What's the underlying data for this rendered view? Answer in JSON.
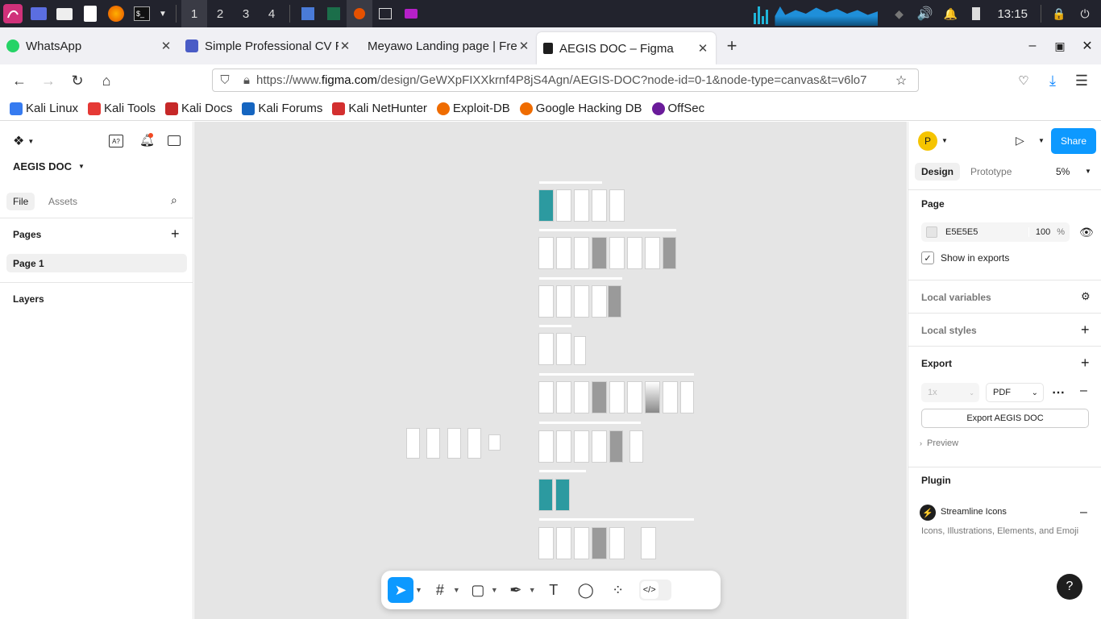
{
  "taskbar": {
    "workspaces": [
      "1",
      "2",
      "3",
      "4"
    ],
    "clock": "13:15"
  },
  "browser": {
    "tabs": [
      {
        "title": "WhatsApp",
        "color": "#25d366"
      },
      {
        "title": "Simple Professional CV Re",
        "color": "#4a5cc6"
      },
      {
        "title": "Meyawo Landing page | Free",
        "color": "#ffffff"
      },
      {
        "title": "AEGIS DOC – Figma",
        "color": "#1e1e1e"
      }
    ],
    "url_prefix": "https://www.",
    "url_domain": "figma.com",
    "url_rest": "/design/GeWXpFIXXkrnf4P8jS4Agn/AEGIS-DOC?node-id=0-1&node-type=canvas&t=v6lo7",
    "bookmarks": [
      {
        "label": "Kali Linux",
        "color": "#367bf0"
      },
      {
        "label": "Kali Tools",
        "color": "#e53935"
      },
      {
        "label": "Kali Docs",
        "color": "#c62828"
      },
      {
        "label": "Kali Forums",
        "color": "#1565c0"
      },
      {
        "label": "Kali NetHunter",
        "color": "#d32f2f"
      },
      {
        "label": "Exploit-DB",
        "color": "#ef6c00"
      },
      {
        "label": "Google Hacking DB",
        "color": "#ef6c00"
      },
      {
        "label": "OffSec",
        "color": "#6a1b9a"
      }
    ]
  },
  "figma": {
    "file_name": "AEGIS DOC",
    "left_tabs": {
      "file": "File",
      "assets": "Assets"
    },
    "pages_label": "Pages",
    "page_item": "Page 1",
    "layers_label": "Layers",
    "avatar": "P",
    "share": "Share",
    "right_tabs": {
      "design": "Design",
      "prototype": "Prototype",
      "zoom": "5%"
    },
    "page_section": "Page",
    "bg_color": "E5E5E5",
    "bg_opacity": "100",
    "percent": "%",
    "show_in_exports": "Show in exports",
    "local_variables": "Local variables",
    "local_styles": "Local styles",
    "export": "Export",
    "export_scale": "1x",
    "export_format": "PDF",
    "export_button": "Export AEGIS DOC",
    "preview": "Preview",
    "plugin": "Plugin",
    "plugin_name": "Streamline Icons",
    "plugin_desc": "Icons, Illustrations, Elements, and Emoji",
    "help": "?"
  }
}
